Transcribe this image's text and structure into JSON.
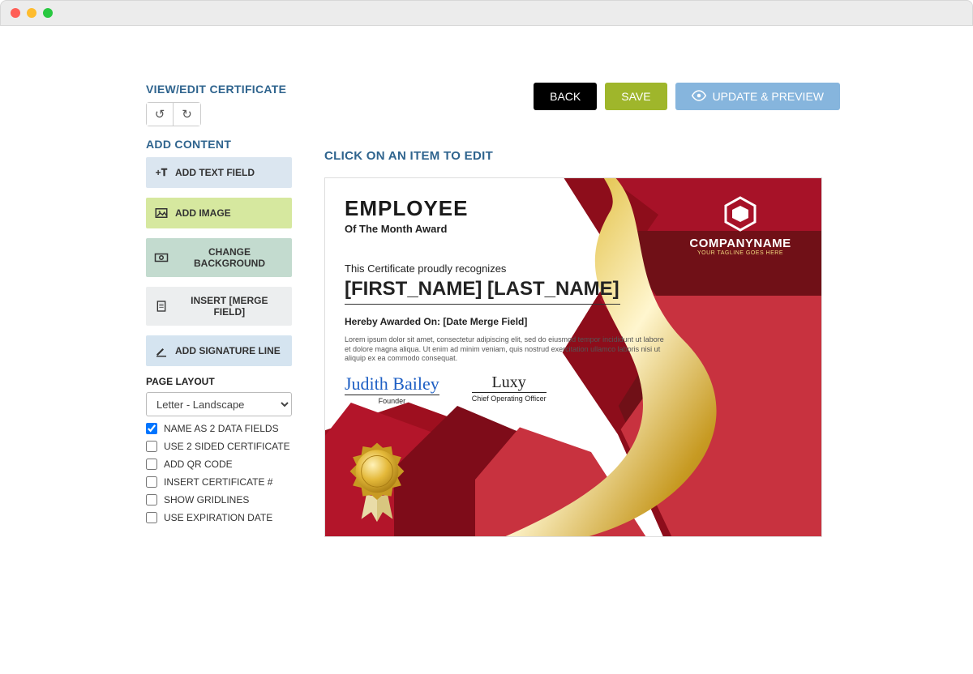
{
  "header": {
    "title": "VIEW/EDIT CERTIFICATE",
    "add_content": "ADD CONTENT",
    "back": "BACK",
    "save": "SAVE",
    "preview": "UPDATE & PREVIEW"
  },
  "tools": {
    "text": "ADD TEXT FIELD",
    "image": "ADD IMAGE",
    "bg": "CHANGE BACKGROUND",
    "merge": "INSERT [MERGE FIELD]",
    "sig": "ADD SIGNATURE LINE"
  },
  "layout": {
    "title": "PAGE LAYOUT",
    "selected": "Letter - Landscape",
    "options": [
      {
        "label": "NAME AS 2 DATA FIELDS",
        "checked": true
      },
      {
        "label": "USE 2 SIDED CERTIFICATE",
        "checked": false
      },
      {
        "label": "ADD QR CODE",
        "checked": false
      },
      {
        "label": "INSERT CERTIFICATE #",
        "checked": false
      },
      {
        "label": "SHOW GRIDLINES",
        "checked": false
      },
      {
        "label": "USE EXPIRATION DATE",
        "checked": false
      }
    ]
  },
  "main": {
    "title": "CLICK ON AN ITEM TO EDIT"
  },
  "cert": {
    "title": "EMPLOYEE",
    "subtitle": "Of The Month Award",
    "recognizes": "This Certificate proudly recognizes",
    "name": "[FIRST_NAME] [LAST_NAME]",
    "awarded": "Hereby Awarded On: [Date Merge Field]",
    "lorem": "Lorem ipsum dolor sit amet, consectetur adipiscing elit, sed do eiusmod tempor incididunt ut labore et dolore magna aliqua. Ut enim ad minim veniam, quis nostrud exercitation ullamco laboris nisi ut aliquip ex ea commodo consequat.",
    "sig1": "Judith Bailey",
    "role1": "Founder",
    "sig2": "Luxy",
    "role2": "Chief Operating Officer",
    "company": "COMPANYNAME",
    "tagline": "YOUR TAGLINE GOES HERE"
  }
}
